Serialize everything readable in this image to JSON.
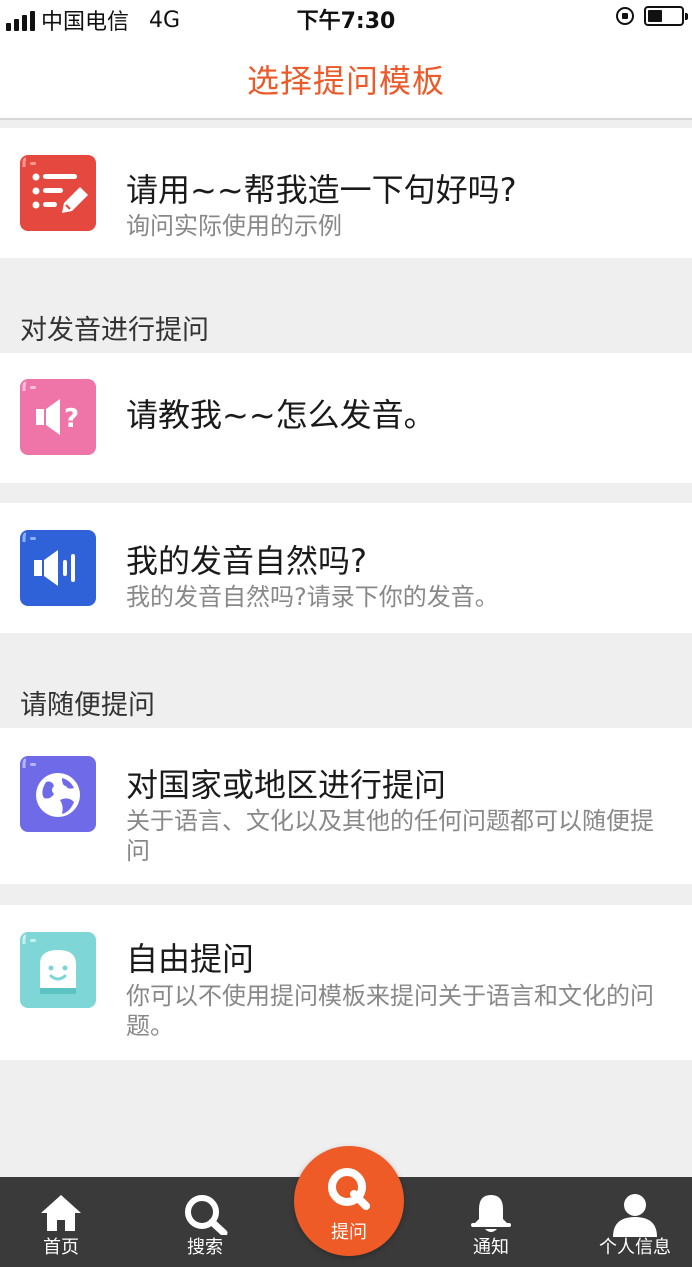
{
  "status_bar": {
    "carrier": "中国电信",
    "network": "4G",
    "time": "下午7:30"
  },
  "header": {
    "title": "选择提问模板"
  },
  "sections": [
    {
      "label": "",
      "items": [
        {
          "icon": "edit-list-icon",
          "color": "#e5483e",
          "title": "请用~~帮我造一下句好吗?",
          "subtitle": "询问实际使用的示例"
        }
      ]
    },
    {
      "label": "对发音进行提问",
      "items": [
        {
          "icon": "speaker-question-icon",
          "color": "#ef74a8",
          "title": "请教我~~怎么发音。",
          "subtitle": ""
        },
        {
          "icon": "speaker-sound-icon",
          "color": "#2f62d9",
          "title": "我的发音自然吗?",
          "subtitle": "我的发音自然吗?请录下你的发音。"
        }
      ]
    },
    {
      "label": "请随便提问",
      "items": [
        {
          "icon": "globe-icon",
          "color": "#6f6be8",
          "title": "对国家或地区进行提问",
          "subtitle": "关于语言、文化以及其他的任何问题都可以随便提问"
        },
        {
          "icon": "face-icon",
          "color": "#7fd6d6",
          "title": "自由提问",
          "subtitle": "你可以不使用提问模板来提问关于语言和文化的问题。"
        }
      ]
    }
  ],
  "tab_bar": {
    "home": "首页",
    "search": "搜索",
    "ask": "提问",
    "notifications": "通知",
    "profile": "个人信息"
  },
  "colors": {
    "accent": "#ec5a2a",
    "tab_bar_bg": "#3a3a3a"
  }
}
